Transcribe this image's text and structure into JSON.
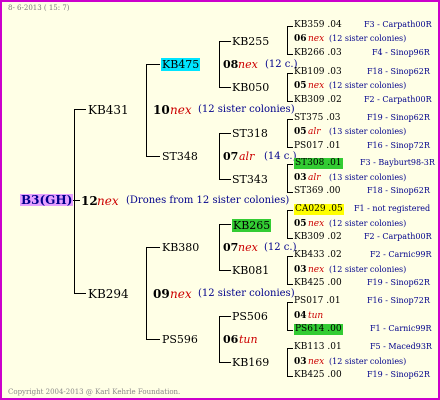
{
  "header": {
    "date_text": "8- 6-2013 ( 15: 7)"
  },
  "footer": {
    "copyright": "Copyright 2004-2013 @ Karl Kehrle Foundation."
  },
  "colors": {
    "border": "#cc00cc",
    "background": "#ffffe6",
    "root_highlight": "#e6a0ff",
    "cyan_highlight": "#00e5ff",
    "green_highlight": "#33cc33",
    "yellow_highlight": "#ffff00"
  },
  "root": {
    "name": "B3(GH)",
    "gen": "12",
    "mark": "nex",
    "note": "(Drones from 12 sister colonies)"
  },
  "level1": [
    {
      "name": "KB431",
      "gen": "10",
      "mark": "nex",
      "note": "(12 sister colonies)"
    },
    {
      "name": "KB294",
      "gen": "09",
      "mark": "nex",
      "note": "(12 sister colonies)"
    }
  ],
  "level2": [
    {
      "name": "KB475",
      "gen": "08",
      "mark": "nex",
      "note": "(12 c.)"
    },
    {
      "name": "ST348",
      "gen": "07",
      "mark": "alr",
      "note": "(14 c.)"
    },
    {
      "name": "KB380",
      "gen": "07",
      "mark": "nex",
      "note": "(12 c.)"
    },
    {
      "name": "PS596",
      "gen": "06",
      "mark": "tun",
      "note": ""
    }
  ],
  "level3": [
    {
      "name": "KB255",
      "gen": "06",
      "mark": "nex",
      "note": "(12 sister colonies)"
    },
    {
      "name": "KB050",
      "gen": "05",
      "mark": "nex",
      "note": "(12 sister colonies)"
    },
    {
      "name": "ST318",
      "gen": "05",
      "mark": "alr",
      "note": "(13 sister colonies)"
    },
    {
      "name": "ST343",
      "gen": "03",
      "mark": "alr",
      "note": "(13 sister colonies)"
    },
    {
      "name": "KB265",
      "gen": "05",
      "mark": "nex",
      "note": "(12 sister colonies)"
    },
    {
      "name": "KB081",
      "gen": "03",
      "mark": "nex",
      "note": "(12 sister colonies)"
    },
    {
      "name": "PS506",
      "gen": "04",
      "mark": "tun",
      "note": ""
    },
    {
      "name": "KB169",
      "gen": "03",
      "mark": "nex",
      "note": "(12 sister colonies)"
    }
  ],
  "leaves": [
    {
      "name": "KB359 .04",
      "origin": "F3 - Carpath00R"
    },
    {
      "name": "KB266 .03",
      "origin": "F4 - Sinop96R"
    },
    {
      "name": "KB109 .03",
      "origin": "F18 - Sinop62R"
    },
    {
      "name": "KB309 .02",
      "origin": "F2 - Carpath00R"
    },
    {
      "name": "ST375 .03",
      "origin": "F19 - Sinop62R"
    },
    {
      "name": "PS017 .01",
      "origin": "F16 - Sinop72R"
    },
    {
      "name": "ST308 .01",
      "origin": "F3 - Bayburt98-3R"
    },
    {
      "name": "ST369 .00",
      "origin": "F18 - Sinop62R"
    },
    {
      "name": "CA029 .05",
      "origin": "F1 - not registered"
    },
    {
      "name": "KB309 .02",
      "origin": "F2 - Carpath00R"
    },
    {
      "name": "KB433 .02",
      "origin": "F2 - Carnic99R"
    },
    {
      "name": "KB425 .00",
      "origin": "F19 - Sinop62R"
    },
    {
      "name": "PS017 .01",
      "origin": "F16 - Sinop72R"
    },
    {
      "name": "PS614 .00",
      "origin": "F1 - Carnic99R"
    },
    {
      "name": "KB113 .01",
      "origin": "F5 - Maced93R"
    },
    {
      "name": "KB425 .00",
      "origin": "F19 - Sinop62R"
    }
  ]
}
